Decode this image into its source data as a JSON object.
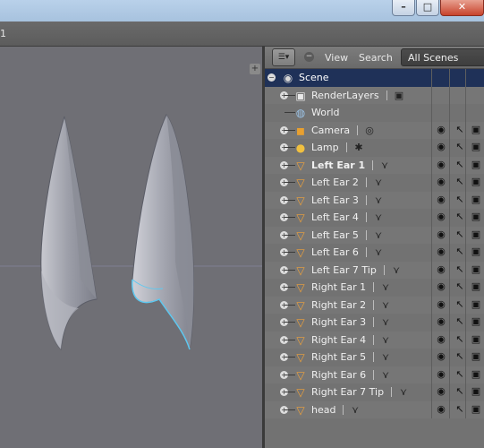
{
  "infobar": {
    "text": "1"
  },
  "window_controls": {
    "minimize": "–",
    "maximize": "□",
    "close": "✕"
  },
  "outliner": {
    "header": {
      "type_icon": "editor-type-icon",
      "view_label": "View",
      "search_label": "Search",
      "scenes_value": "All Scenes"
    },
    "rows": [
      {
        "label": "Scene",
        "icon": "scene-icon",
        "level": 0,
        "selected": true,
        "expand": "−"
      },
      {
        "label": "RenderLayers",
        "icon": "render-layers-icon",
        "level": 1,
        "expand": "+"
      },
      {
        "label": "World",
        "icon": "world-icon",
        "level": 1
      },
      {
        "label": "Camera",
        "icon": "camera-icon",
        "level": 1,
        "expand": "+"
      },
      {
        "label": "Lamp",
        "icon": "lamp-icon",
        "level": 1,
        "expand": "+"
      },
      {
        "label": "Left Ear 1",
        "icon": "mesh-icon",
        "level": 1,
        "expand": "+",
        "active": true
      },
      {
        "label": "Left Ear 2",
        "icon": "mesh-icon",
        "level": 1,
        "expand": "+"
      },
      {
        "label": "Left Ear 3",
        "icon": "mesh-icon",
        "level": 1,
        "expand": "+"
      },
      {
        "label": "Left Ear 4",
        "icon": "mesh-icon",
        "level": 1,
        "expand": "+"
      },
      {
        "label": "Left Ear 5",
        "icon": "mesh-icon",
        "level": 1,
        "expand": "+"
      },
      {
        "label": "Left Ear 6",
        "icon": "mesh-icon",
        "level": 1,
        "expand": "+"
      },
      {
        "label": "Left Ear 7 Tip",
        "icon": "mesh-icon",
        "level": 1,
        "expand": "+"
      },
      {
        "label": "Right Ear 1",
        "icon": "mesh-icon",
        "level": 1,
        "expand": "+"
      },
      {
        "label": "Right Ear 2",
        "icon": "mesh-icon",
        "level": 1,
        "expand": "+"
      },
      {
        "label": "Right Ear 3",
        "icon": "mesh-icon",
        "level": 1,
        "expand": "+"
      },
      {
        "label": "Right Ear 4",
        "icon": "mesh-icon",
        "level": 1,
        "expand": "+"
      },
      {
        "label": "Right Ear 5",
        "icon": "mesh-icon",
        "level": 1,
        "expand": "+"
      },
      {
        "label": "Right Ear 6",
        "icon": "mesh-icon",
        "level": 1,
        "expand": "+"
      },
      {
        "label": "Right Ear 7 Tip",
        "icon": "mesh-icon",
        "level": 1,
        "expand": "+"
      },
      {
        "label": "head",
        "icon": "mesh-icon",
        "level": 1,
        "expand": "+"
      }
    ]
  },
  "colors": {
    "selection": "#1f3158",
    "mesh_icon": "#f0a23a",
    "viewport_bg": "#6f6f75",
    "highlight_edge": "#5ec8f0"
  }
}
